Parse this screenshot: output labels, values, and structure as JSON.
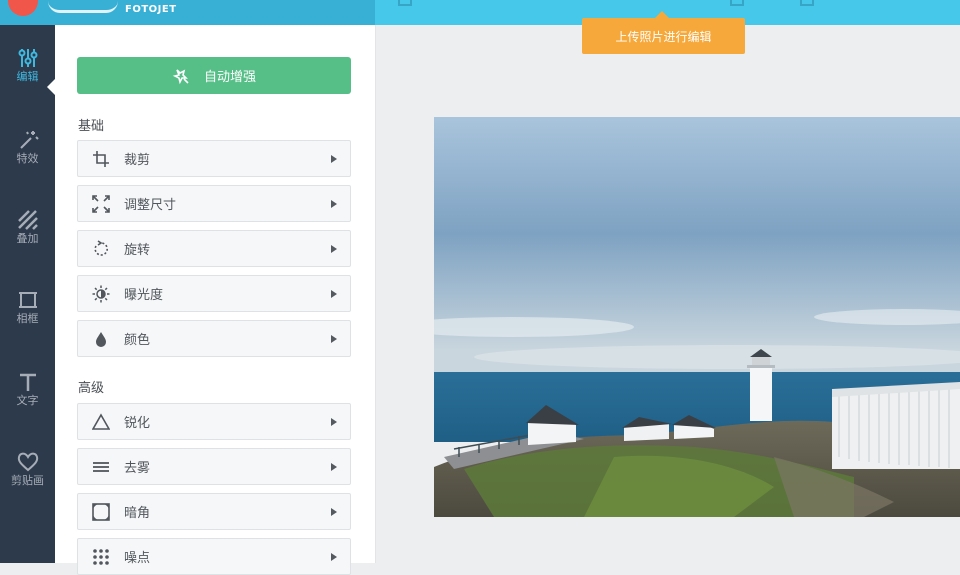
{
  "brand": {
    "name": "FOTOJET"
  },
  "tooltip": {
    "text": "上传照片进行编辑"
  },
  "rail": {
    "items": [
      {
        "label": "编辑",
        "icon": "sliders-icon",
        "active": true
      },
      {
        "label": "特效",
        "icon": "magic-wand-icon",
        "active": false
      },
      {
        "label": "叠加",
        "icon": "overlay-stripes-icon",
        "active": false
      },
      {
        "label": "相框",
        "icon": "frame-icon",
        "active": false
      },
      {
        "label": "文字",
        "icon": "text-icon",
        "active": false
      },
      {
        "label": "剪贴画",
        "icon": "heart-icon",
        "active": false
      }
    ]
  },
  "panel": {
    "auto_enhance": {
      "label": "自动增强",
      "icon": "magic-wand-icon"
    },
    "basic": {
      "title": "基础",
      "tools": [
        {
          "label": "裁剪",
          "icon": "crop-icon"
        },
        {
          "label": "调整尺寸",
          "icon": "resize-icon"
        },
        {
          "label": "旋转",
          "icon": "rotate-icon"
        },
        {
          "label": "曝光度",
          "icon": "sun-icon"
        },
        {
          "label": "颜色",
          "icon": "droplet-icon"
        }
      ]
    },
    "advanced": {
      "title": "高级",
      "tools": [
        {
          "label": "锐化",
          "icon": "triangle-icon"
        },
        {
          "label": "去雾",
          "icon": "dehaze-lines-icon"
        },
        {
          "label": "暗角",
          "icon": "vignette-icon"
        },
        {
          "label": "噪点",
          "icon": "noise-dots-icon"
        }
      ]
    }
  },
  "colors": {
    "header": "#45c8ea",
    "rail": "#2d3a4b",
    "accent": "#3fb8e0",
    "auto_button": "#55bf87",
    "tooltip": "#f7a83a"
  }
}
